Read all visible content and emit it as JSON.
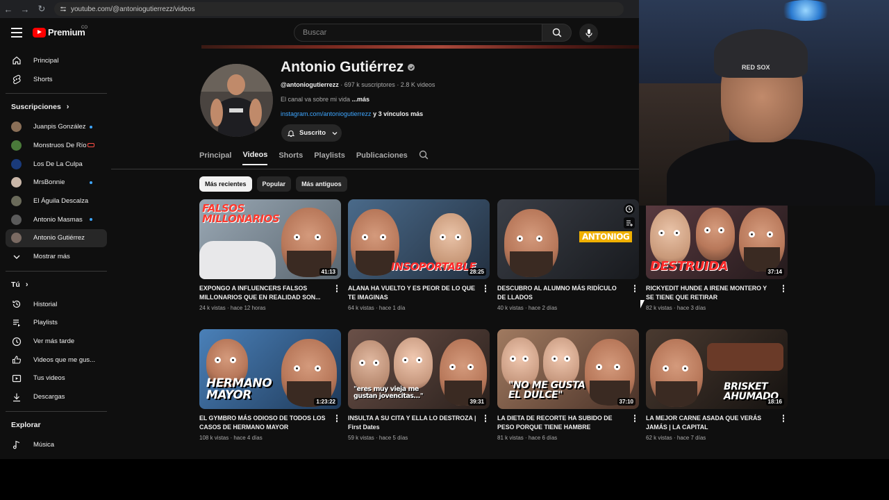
{
  "browser": {
    "url": "youtube.com/@antoniogutierrezz/videos"
  },
  "header": {
    "logo_text": "Premium",
    "logo_badge": "CO",
    "search_placeholder": "Buscar"
  },
  "sidebar": {
    "main": [
      {
        "label": "Principal",
        "icon": "home-icon"
      },
      {
        "label": "Shorts",
        "icon": "shorts-icon"
      }
    ],
    "subscriptions_heading": "Suscripciones",
    "subscriptions": [
      {
        "label": "Juanpis González",
        "badge": "dot",
        "color": "#8a6f57"
      },
      {
        "label": "Monstruos De Río",
        "badge": "live",
        "color": "#4a7a3a"
      },
      {
        "label": "Los De La Culpa",
        "badge": "",
        "color": "#1a3a7a"
      },
      {
        "label": "MrsBonnie",
        "badge": "dot",
        "color": "#c9b6a8"
      },
      {
        "label": "El Águila Descalza",
        "badge": "",
        "color": "#6a6a5a"
      },
      {
        "label": "Antonio Masmas",
        "badge": "dot",
        "color": "#5a5a5a"
      },
      {
        "label": "Antonio Gutiérrez",
        "badge": "",
        "color": "#7a6a62"
      }
    ],
    "show_more": "Mostrar más",
    "you_heading": "Tú",
    "you_items": [
      {
        "label": "Historial",
        "icon": "history-icon"
      },
      {
        "label": "Playlists",
        "icon": "playlists-icon"
      },
      {
        "label": "Ver más tarde",
        "icon": "watch-later-icon"
      },
      {
        "label": "Videos que me gus...",
        "icon": "like-icon"
      },
      {
        "label": "Tus videos",
        "icon": "your-videos-icon"
      },
      {
        "label": "Descargas",
        "icon": "download-icon"
      }
    ],
    "explore_heading": "Explorar",
    "explore_items": [
      {
        "label": "Música",
        "icon": "music-icon"
      }
    ]
  },
  "channel": {
    "name": "Antonio Gutiérrez",
    "handle": "@antoniogutierrezz",
    "stats": " · 697 k suscriptores · 2.8 K videos",
    "description": "El canal va sobre mi vida ",
    "description_more": "...más",
    "link": "instagram.com/antoniogutierrezz",
    "link_more": " y 3 vínculos más",
    "subscribe_label": "Suscrito",
    "tabs": [
      "Principal",
      "Videos",
      "Shorts",
      "Playlists",
      "Publicaciones"
    ],
    "chips": [
      "Más recientes",
      "Popular",
      "Más antiguos"
    ]
  },
  "videos": [
    {
      "title": "EXPONGO A INFLUENCERS FALSOS MILLONARIOS QUE EN REALIDAD SON...",
      "views": "24 k vistas",
      "age": "hace 12 horas",
      "duration": "41:13",
      "thumb_text": "FALSOS MILLONARIOS",
      "bg": "#7a8a96"
    },
    {
      "title": "ALANA HA VUELTO Y ES PEOR DE LO QUE TE IMAGINAS",
      "views": "64 k vistas",
      "age": "hace 1 día",
      "duration": "28:25",
      "thumb_text": "INSOPORTABLE",
      "bg": "#3a4e6a"
    },
    {
      "title": "DESCUBRO AL ALUMNO MÁS RIDÍCULO DE LLADOS",
      "views": "40 k vistas",
      "age": "hace 2 días",
      "duration": "",
      "thumb_text": "ANTONIOG",
      "bg": "#2a2e36"
    },
    {
      "title": "RICKYEDIT HUNDE A IRENE MONTERO Y SE TIENE QUE RETIRAR",
      "views": "82 k vistas",
      "age": "hace 3 días",
      "duration": "37:14",
      "thumb_text": "DESTRUIDA",
      "bg": "#3a2a2e"
    },
    {
      "title": "EL GYMBRO MÁS ODIOSO DE TODOS LOS CASOS DE HERMANO MAYOR",
      "views": "108 k vistas",
      "age": "hace 4 días",
      "duration": "1:23:22",
      "thumb_text": "HERMANO MAYOR",
      "bg": "#3a6a9a"
    },
    {
      "title": "INSULTA A SU CITA Y ELLA LO DESTROZA | First Dates",
      "views": "59 k vistas",
      "age": "hace 5 días",
      "duration": "39:31",
      "thumb_text": "\"eres muy vieja me gustan jovencitas...\"",
      "bg": "#4a3a36"
    },
    {
      "title": "LA DIETA DE RECORTE HA SUBIDO DE PESO PORQUE TIENE HAMBRE",
      "views": "81 k vistas",
      "age": "hace 6 días",
      "duration": "37:10",
      "thumb_text": "\"NO ME GUSTA EL DULCE\"",
      "bg": "#6a4a3a"
    },
    {
      "title": "LA MEJOR CARNE ASADA QUE VERÁS JAMÁS | LA CAPITAL",
      "views": "62 k vistas",
      "age": "hace 7 días",
      "duration": "18:16",
      "thumb_text": "BRISKET AHUMADO",
      "bg": "#2a2622"
    }
  ],
  "webcam": {
    "cap_text": "RED SOX"
  }
}
